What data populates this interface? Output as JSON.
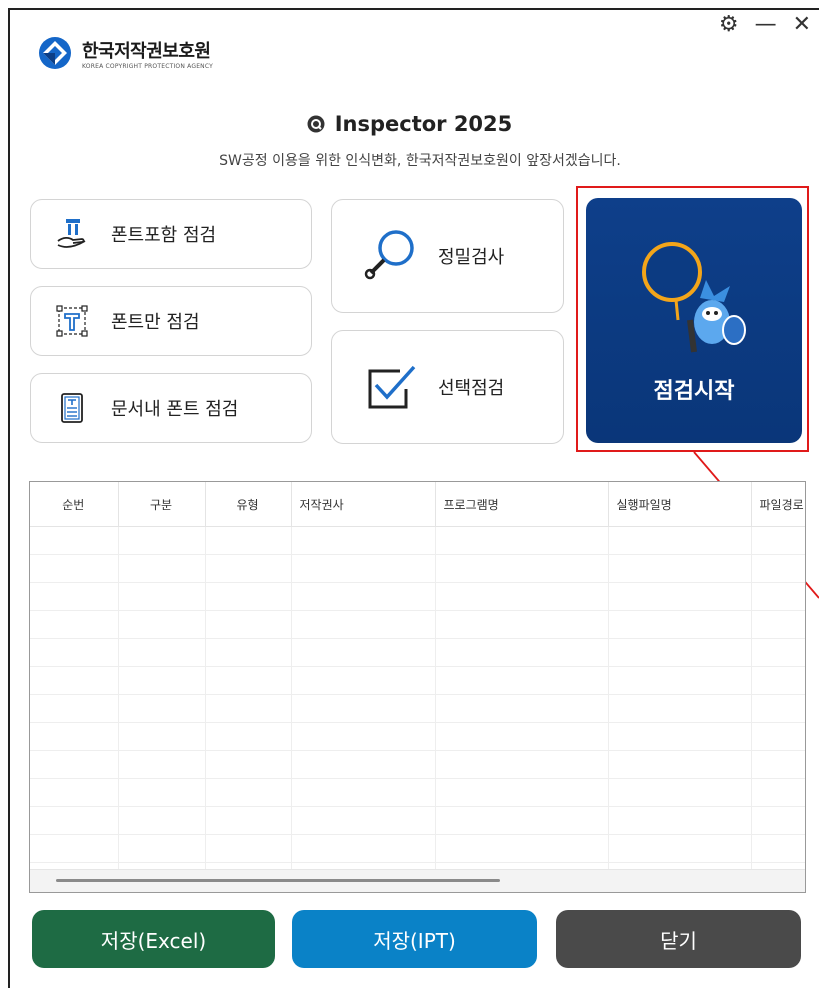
{
  "window": {
    "controls": {
      "settings": "⚙",
      "minimize": "—",
      "close": "✕"
    }
  },
  "logo": {
    "name_ko": "한국저작권보호원",
    "name_en": "KOREA COPYRIGHT PROTECTION AGENCY"
  },
  "header": {
    "title": "Inspector 2025",
    "subtitle": "SW공정 이용을 위한 인식변화, 한국저작권보호원이 앞장서겠습니다."
  },
  "actions": {
    "font_included": "폰트포함 점검",
    "font_only": "폰트만 점검",
    "doc_font": "문서내 폰트 점검",
    "precise": "정밀검사",
    "selective": "선택점검",
    "start": "점검시작"
  },
  "table": {
    "columns": [
      "순번",
      "구분",
      "유형",
      "저작권사",
      "프로그램명",
      "실행파일명",
      "파일경로"
    ]
  },
  "footer": {
    "save_excel": "저장(Excel)",
    "save_ipt": "저장(IPT)",
    "close": "닫기"
  },
  "colors": {
    "start_bg": "#0e3f8a",
    "highlight": "#e01a1a",
    "excel_btn": "#1e6b44",
    "ipt_btn": "#0a82c7",
    "close_btn": "#4a4a4a"
  }
}
